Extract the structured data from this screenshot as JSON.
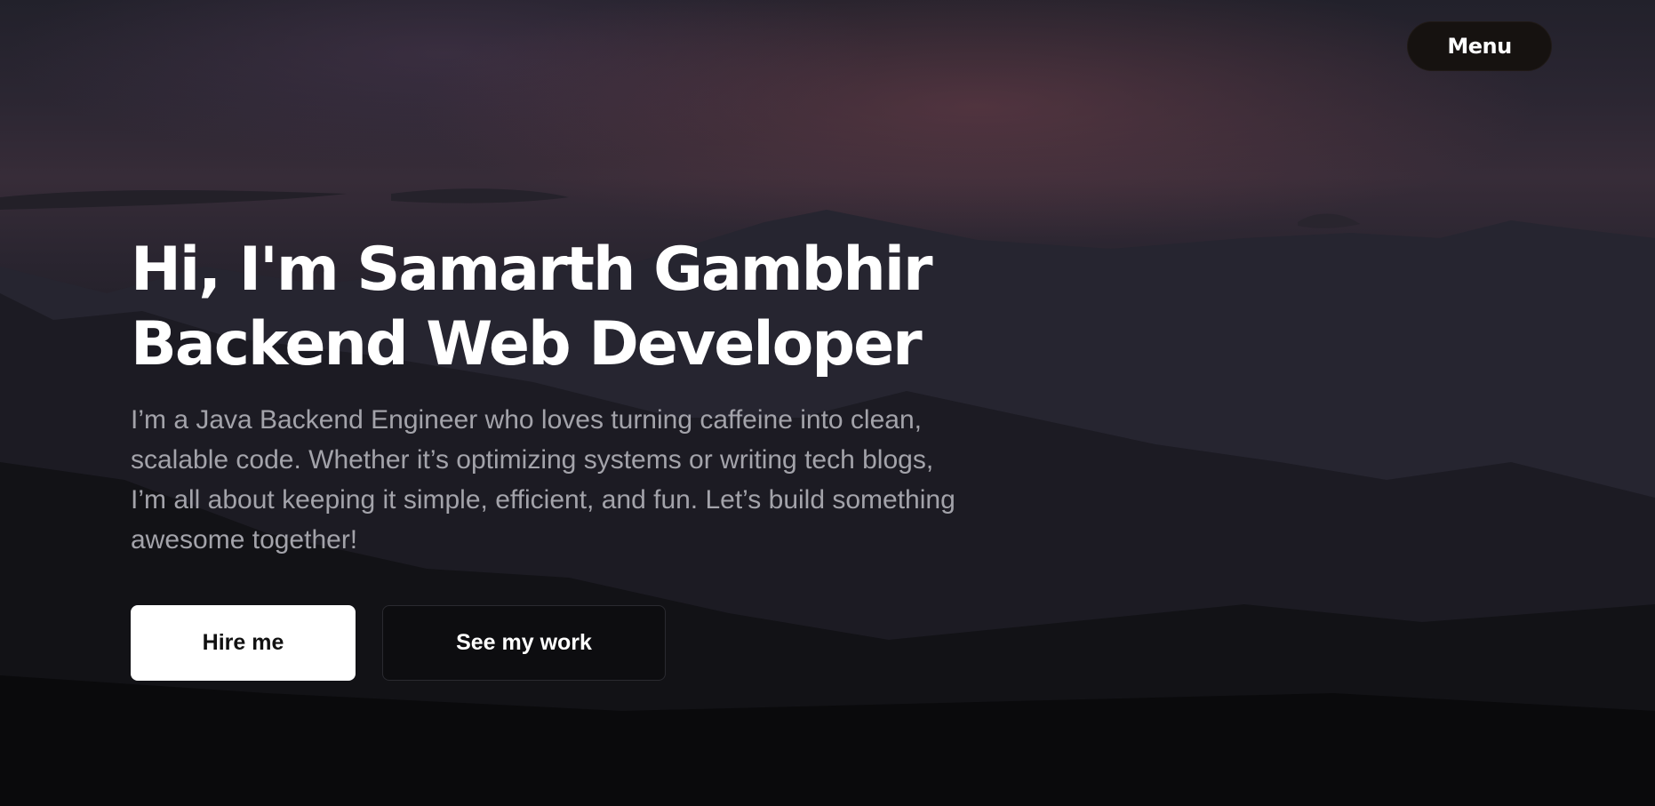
{
  "nav": {
    "menu_label": "Menu"
  },
  "hero": {
    "headline_line1": "Hi, I'm Samarth Gambhir",
    "headline_line2": "Backend Web Developer",
    "bio": "I’m a Java Backend Engineer who loves turning caffeine into clean, scalable code. Whether it’s optimizing systems or writing tech blogs, I’m all about keeping it simple, efficient, and fun. Let’s build something awesome together!"
  },
  "actions": {
    "hire_label": "Hire me",
    "work_label": "See my work"
  },
  "colors": {
    "background": "#0b0b0e",
    "sky_accent": "#372c38",
    "text_primary": "#ffffff",
    "text_secondary": "#a3a3aa",
    "menu_background": "#161210"
  }
}
